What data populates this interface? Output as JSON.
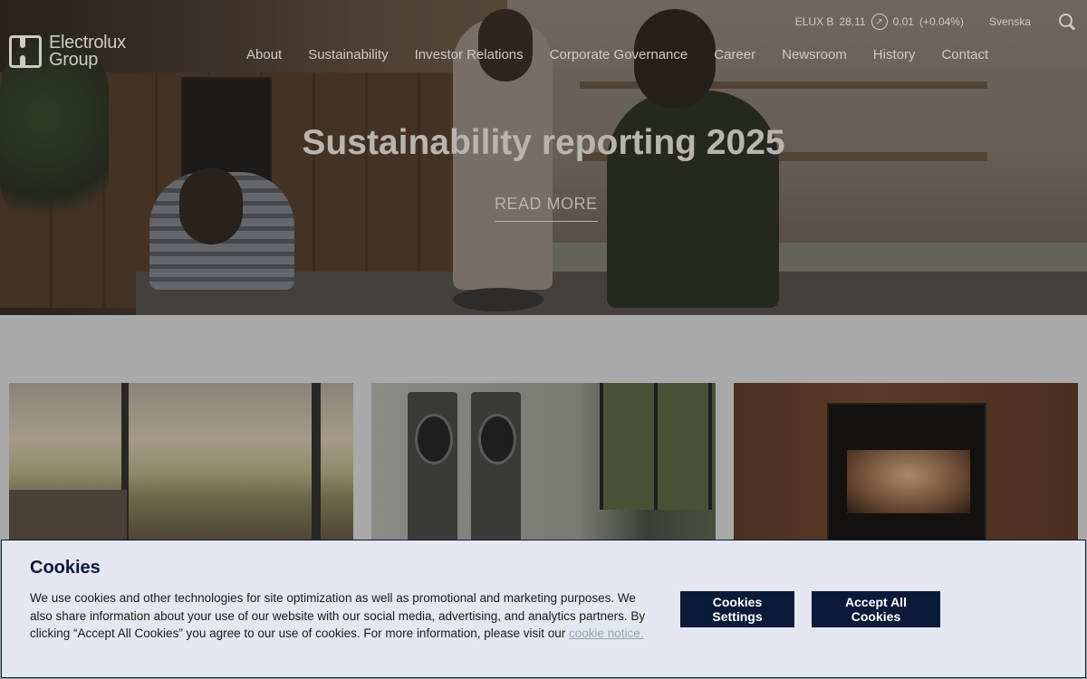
{
  "brand": {
    "logo_line1": "Electrolux",
    "logo_line2": "Group"
  },
  "topbar": {
    "ticker_symbol": "ELUX B",
    "ticker_price": "28.11",
    "ticker_change": "0.01",
    "ticker_change_pct": "(+0.04%)",
    "language": "Svenska"
  },
  "nav": {
    "items": [
      {
        "label": "About"
      },
      {
        "label": "Sustainability"
      },
      {
        "label": "Investor Relations"
      },
      {
        "label": "Corporate Governance"
      },
      {
        "label": "Career"
      },
      {
        "label": "Newsroom"
      },
      {
        "label": "History"
      },
      {
        "label": "Contact"
      }
    ]
  },
  "hero": {
    "title": "Sustainability reporting 2025",
    "cta": "READ MORE"
  },
  "cookie": {
    "title": "Cookies",
    "body": "We use cookies and other technologies for site optimization as well as promotional and marketing purposes. We also share information about your use of our website with our social media, advertising, and analytics partners. By clicking “Accept All Cookies” you agree to our use of cookies. For more information, please visit our ",
    "link": "cookie notice.",
    "settings_label": "Cookies Settings",
    "accept_label": "Accept All Cookies"
  },
  "colors": {
    "navy": "#0c1a3a",
    "banner_bg": "#e4e7ef"
  }
}
